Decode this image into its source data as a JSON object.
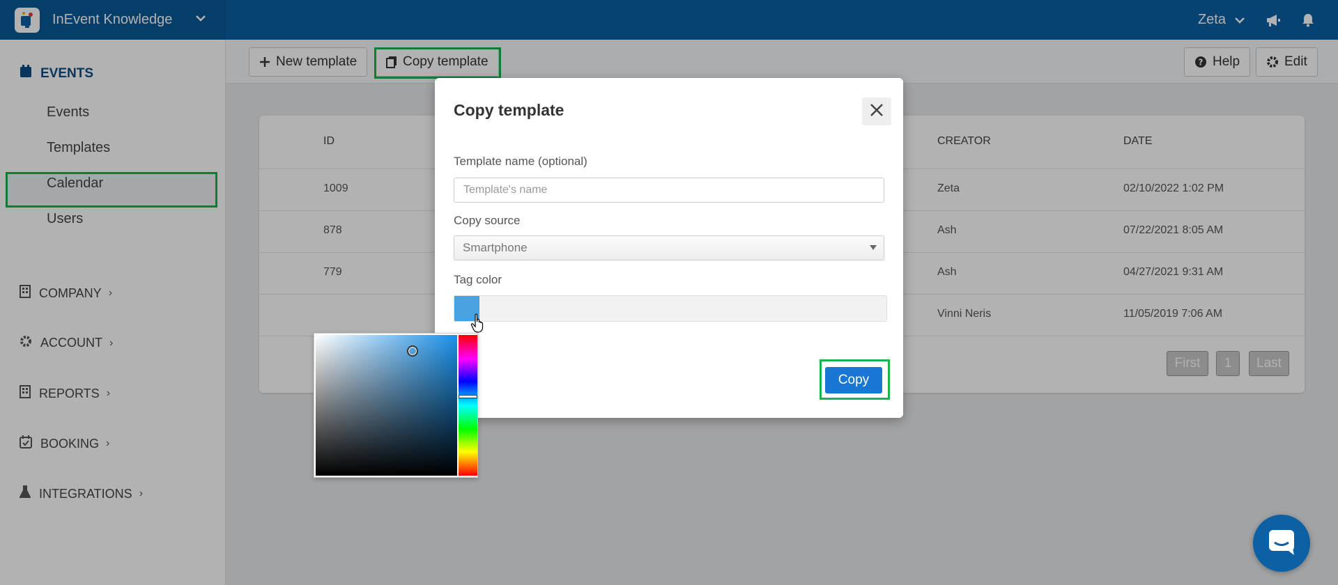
{
  "topbar": {
    "app_name": "InEvent Knowledge",
    "user_name": "Zeta"
  },
  "sidebar": {
    "events_section": "EVENTS",
    "event_items": [
      {
        "label": "Events"
      },
      {
        "label": "Templates"
      },
      {
        "label": "Calendar"
      },
      {
        "label": "Users"
      }
    ],
    "sections": [
      {
        "label": "COMPANY"
      },
      {
        "label": "ACCOUNT"
      },
      {
        "label": "REPORTS"
      },
      {
        "label": "BOOKING"
      },
      {
        "label": "INTEGRATIONS"
      }
    ]
  },
  "toolbar": {
    "new_template": "New template",
    "copy_template": "Copy template",
    "help": "Help",
    "edit": "Edit"
  },
  "table": {
    "columns": {
      "id": "ID",
      "creator": "CREATOR",
      "date": "DATE"
    },
    "rows": [
      {
        "id": "1009",
        "creator": "Zeta",
        "date": "02/10/2022 1:02 PM"
      },
      {
        "id": "878",
        "creator": "Ash",
        "date": "07/22/2021 8:05 AM"
      },
      {
        "id": "779",
        "creator": "Ash",
        "date": "04/27/2021 9:31 AM"
      },
      {
        "id": "",
        "creator": "Vinni Neris",
        "date": "11/05/2019 7:06 AM"
      }
    ],
    "pagination": {
      "first": "First",
      "page": "1",
      "last": "Last"
    }
  },
  "modal": {
    "title": "Copy template",
    "name_label": "Template name (optional)",
    "name_placeholder": "Template's name",
    "source_label": "Copy source",
    "source_value": "Smartphone",
    "tag_label": "Tag color",
    "tag_color": "#4aa3e0",
    "copy_button": "Copy"
  },
  "colors": {
    "topbar": "#0b61a4",
    "highlight": "#19b44b",
    "primary_button": "#1976d2"
  }
}
